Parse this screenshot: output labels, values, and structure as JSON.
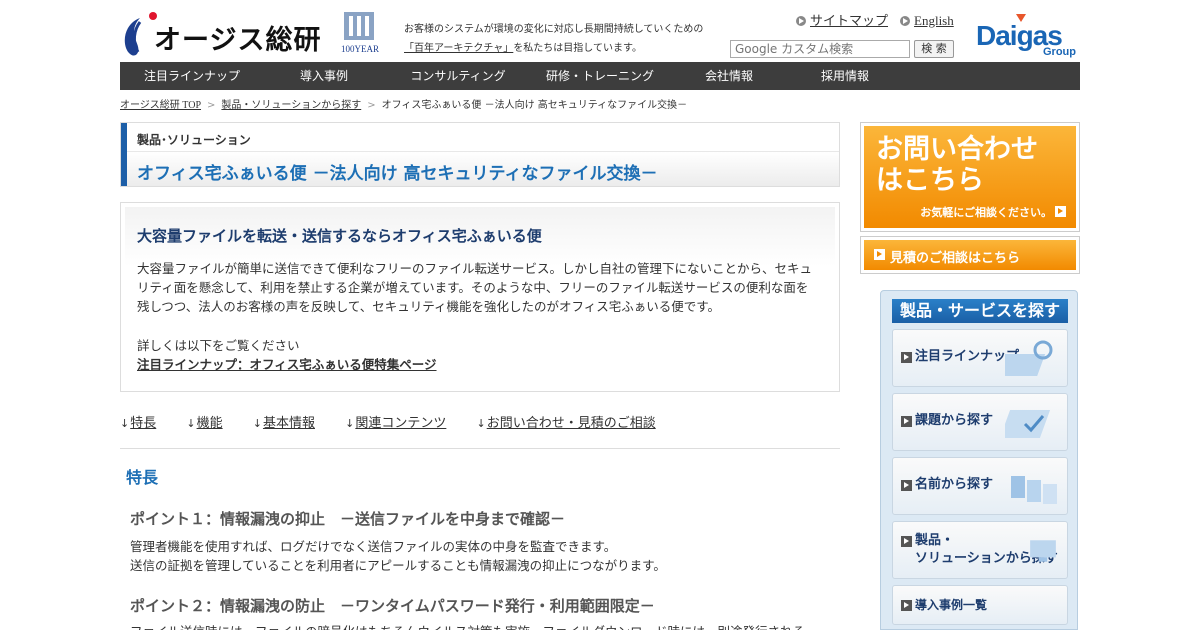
{
  "header": {
    "logo_text": "オージス総研",
    "badge_label": "100YEAR",
    "tagline_line1": "お客様のシステムが環境の変化に対応し長期間持続していくための",
    "tagline_link": "「百年アーキテクチャ」",
    "tagline_line2": "を私たちは目指しています。",
    "sitemap_label": "サイトマップ",
    "english_label": "English",
    "search_placeholder": "Google カスタム検索",
    "search_button": "検 索",
    "daigas_text": "Daigas",
    "daigas_sub": "Group"
  },
  "nav": {
    "items": [
      {
        "label": "注目ラインナップ"
      },
      {
        "label": "導入事例"
      },
      {
        "label": "コンサルティング"
      },
      {
        "label": "研修・トレーニング"
      },
      {
        "label": "会社情報"
      },
      {
        "label": "採用情報"
      }
    ]
  },
  "breadcrumb": {
    "items": [
      "オージス総研 TOP",
      "製品・ソリューションから探す",
      "オフィス宅ふぁいる便 －法人向け 高セキュリティなファイル交換－"
    ]
  },
  "title": {
    "category": "製品･ソリューション",
    "heading": "オフィス宅ふぁいる便 －法人向け 高セキュリティなファイル交換－"
  },
  "intro": {
    "heading": "大容量ファイルを転送・送信するならオフィス宅ふぁいる便",
    "body": "大容量ファイルが簡単に送信できて便利なフリーのファイル転送サービス。しかし自社の管理下にないことから、セキュリティ面を懸念して、利用を禁止する企業が増えています。そのような中、フリーのファイル転送サービスの便利な面を残しつつ、法人のお客様の声を反映して、セキュリティ機能を強化したのがオフィス宅ふぁいる便です。",
    "more_text": "詳しくは以下をご覧ください",
    "more_link": "注目ラインナップ：オフィス宅ふぁいる便特集ページ"
  },
  "anchors": {
    "items": [
      "特長",
      "機能",
      "基本情報",
      "関連コンテンツ",
      "お問い合わせ・見積のご相談"
    ]
  },
  "features": {
    "section_title": "特長",
    "point1_title": "ポイント１：情報漏洩の抑止　－送信ファイルを中身まで確認－",
    "point1_line1": "管理者機能を使用すれば、ログだけでなく送信ファイルの実体の中身を監査できます。",
    "point1_line2": "送信の証拠を管理していることを利用者にアピールすることも情報漏洩の抑止につながります。",
    "point2_title": "ポイント２：情報漏洩の防止　－ワンタイムパスワード発行・利用範囲限定－",
    "point2_line1": "ファイル送信時には、ファイルの暗号化はもちろんウイルス対策も実施。ファイルダウンロード時には、別途発行される"
  },
  "sidebar": {
    "contact_big_line1": "お問い合わせ",
    "contact_big_line2": "はこちら",
    "contact_small": "お気軽にご相談ください。",
    "quote_label": "見積のご相談はこちら",
    "panel_title": "製品・サービスを探す",
    "buttons": [
      {
        "label": "注目ラインナップ"
      },
      {
        "label": "課題から探す"
      },
      {
        "label": "名前から探す"
      },
      {
        "label_line1": "製品・",
        "label_line2": "ソリューションから探す"
      },
      {
        "label": "導入事例一覧"
      }
    ]
  },
  "colors": {
    "nav_bg": "#3d3d3d",
    "accent_blue": "#1d6fb5",
    "orange": "#f28a00"
  }
}
